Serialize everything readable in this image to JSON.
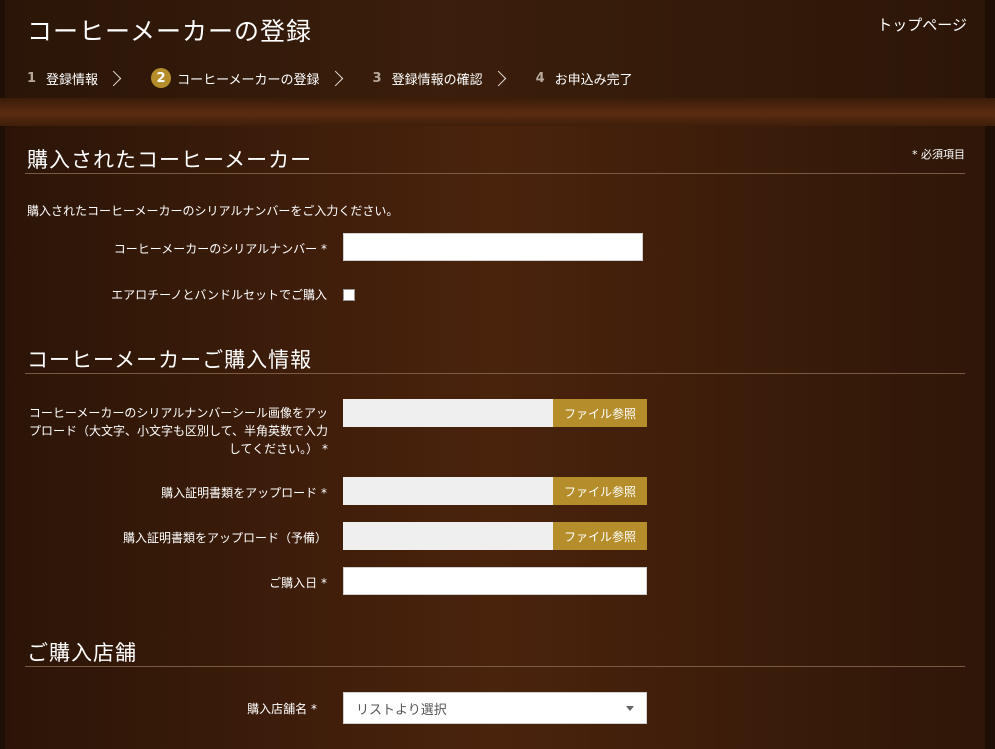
{
  "header": {
    "title": "コーヒーメーカーの登録",
    "top_link": "トップページ",
    "steps": [
      {
        "num": "1",
        "label": "登録情報"
      },
      {
        "num": "2",
        "label": "コーヒーメーカーの登録"
      },
      {
        "num": "3",
        "label": "登録情報の確認"
      },
      {
        "num": "4",
        "label": "お申込み完了"
      }
    ],
    "active_step": "2"
  },
  "section1": {
    "title": "購入されたコーヒーメーカー",
    "required_note": "* 必須項目",
    "intro": "購入されたコーヒーメーカーのシリアルナンバーをご入力ください。",
    "serial_label": "コーヒーメーカーのシリアルナンバー *",
    "serial_value": "",
    "bundle_label": "エアロチーノとバンドルセットでご購入",
    "bundle_checked": false
  },
  "section2": {
    "title": "コーヒーメーカーご購入情報",
    "seal_label": "コーヒーメーカーのシリアルナンバーシール画像をアップロード（大文字、小文字も区別して、半角英数で入力してください。） *",
    "proof_label": "購入証明書類をアップロード *",
    "proof_backup_label": "購入証明書類をアップロード（予備）",
    "purchase_date_label": "ご購入日 *",
    "purchase_date_value": "",
    "file_button_label": "ファイル参照"
  },
  "section3": {
    "title": "ご購入店舗",
    "store_label": "購入店舗名 *",
    "store_placeholder": "リストより選択"
  },
  "colors": {
    "accent": "#b58d2b",
    "background": "#1e0e05"
  }
}
